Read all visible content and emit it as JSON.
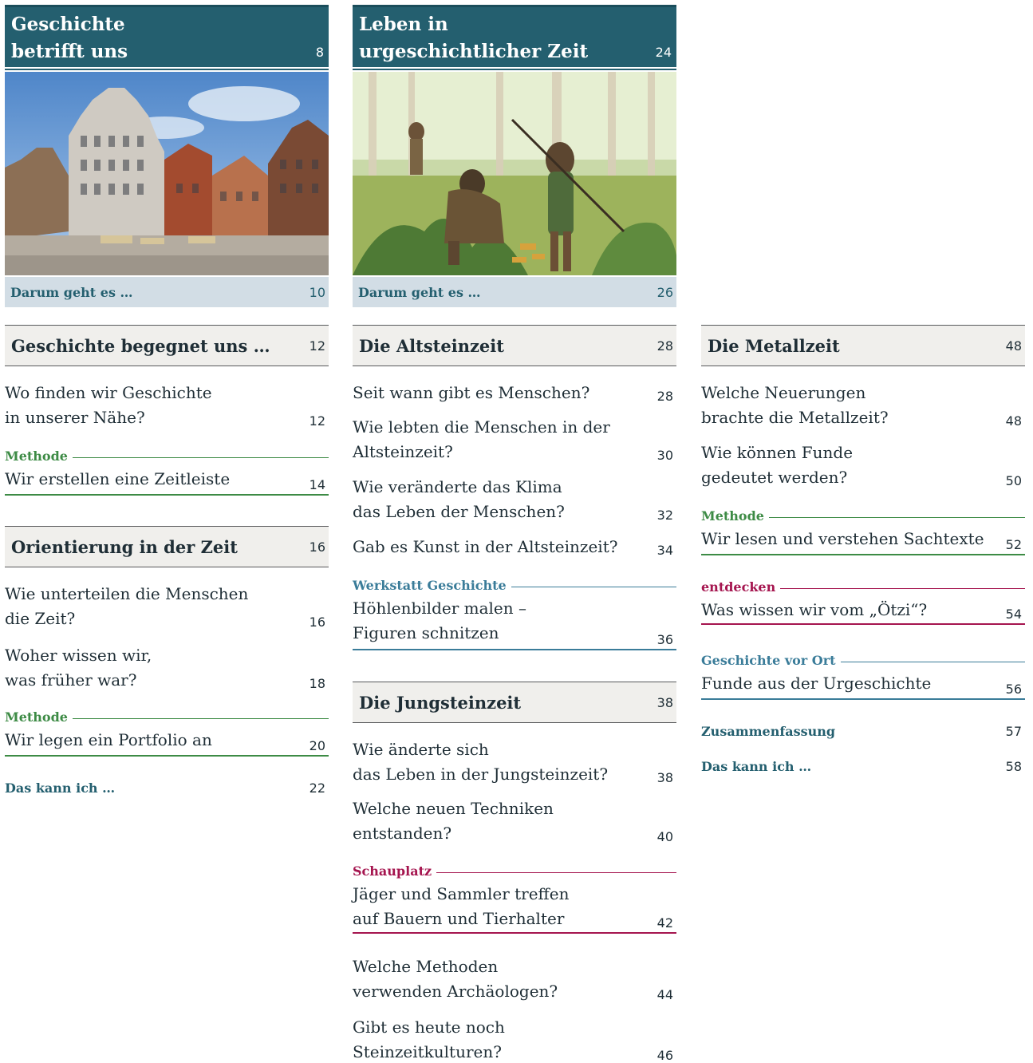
{
  "col1": {
    "chapter": {
      "title_line1": "Geschichte",
      "title_line2": "betrifft uns",
      "page": "8"
    },
    "intro": {
      "label": "Darum geht es …",
      "page": "10"
    },
    "sections": [
      {
        "title": "Geschichte begegnet uns …",
        "page": "12"
      },
      {
        "title": "Orientierung in der Zeit",
        "page": "16"
      }
    ],
    "e1": {
      "line1": "Wo finden wir Geschichte",
      "line2": "in unserer Nähe?",
      "page": "12"
    },
    "m1": {
      "category": "Methode",
      "text": "Wir erstellen eine Zeitleiste",
      "page": "14"
    },
    "e2": {
      "line1": "Wie unterteilen die Menschen",
      "line2": "die Zeit?",
      "page": "16"
    },
    "e3": {
      "line1": "Woher wissen wir,",
      "line2": "was früher war?",
      "page": "18"
    },
    "m2": {
      "category": "Methode",
      "text": "Wir legen ein Portfolio an",
      "page": "20"
    },
    "kann": {
      "label": "Das kann ich …",
      "page": "22"
    }
  },
  "col2": {
    "chapter": {
      "title_line1": "Leben in",
      "title_line2": "urgeschichtlicher Zeit",
      "page": "24"
    },
    "intro": {
      "label": "Darum geht es …",
      "page": "26"
    },
    "sections": [
      {
        "title": "Die Altsteinzeit",
        "page": "28"
      },
      {
        "title": "Die Jungsteinzeit",
        "page": "38"
      }
    ],
    "e1": {
      "line1": "Seit wann gibt es Menschen?",
      "page": "28"
    },
    "e2": {
      "line1": "Wie lebten die Menschen in der",
      "line2": "Altsteinzeit?",
      "page": "30"
    },
    "e3": {
      "line1": "Wie veränderte das Klima",
      "line2": "das Leben der Menschen?",
      "page": "32"
    },
    "e4": {
      "line1": "Gab es Kunst in der Altsteinzeit?",
      "page": "34"
    },
    "w1": {
      "category": "Werkstatt Geschichte",
      "line1": "Höhlenbilder malen –",
      "line2": "Figuren schnitzen",
      "page": "36"
    },
    "e5": {
      "line1": "Wie änderte sich",
      "line2": "das Leben in der Jungsteinzeit?",
      "page": "38"
    },
    "e6": {
      "line1": "Welche neuen Techniken",
      "line2": "entstanden?",
      "page": "40"
    },
    "s1": {
      "category": "Schauplatz",
      "line1": "Jäger und Sammler treffen",
      "line2": "auf Bauern und Tierhalter",
      "page": "42"
    },
    "e7": {
      "line1": "Welche Methoden",
      "line2": "verwenden Archäologen?",
      "page": "44"
    },
    "e8": {
      "line1": "Gibt es heute noch",
      "line2": "Steinzeitkulturen?",
      "page": "46"
    }
  },
  "col3": {
    "section": {
      "title": "Die Metallzeit",
      "page": "48"
    },
    "e1": {
      "line1": "Welche Neuerungen",
      "line2": "brachte die Metallzeit?",
      "page": "48"
    },
    "e2": {
      "line1": "Wie können Funde",
      "line2": "gedeutet werden?",
      "page": "50"
    },
    "m1": {
      "category": "Methode",
      "text": "Wir lesen und verstehen Sachtexte",
      "page": "52"
    },
    "d1": {
      "category": "entdecken",
      "text": "Was wissen wir vom „Ötzi“?",
      "page": "54"
    },
    "g1": {
      "category": "Geschichte vor Ort",
      "text": "Funde aus der Urgeschichte",
      "page": "56"
    },
    "zus": {
      "label": "Zusammenfassung",
      "page": "57"
    },
    "kann": {
      "label": "Das kann ich …",
      "page": "58"
    }
  },
  "colors": {
    "chapter": "#245f6f",
    "methode": "#3d8b45",
    "werkstatt": "#3a7c99",
    "schauplatz": "#a5154f"
  }
}
